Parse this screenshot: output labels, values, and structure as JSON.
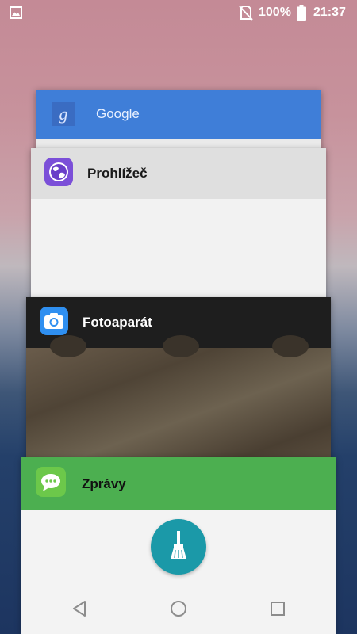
{
  "status_bar": {
    "icons": [
      "image-notification-icon",
      "no-sim-icon",
      "battery-full-icon"
    ],
    "battery": "100%",
    "time": "21:37"
  },
  "recent_apps": [
    {
      "name": "Google",
      "icon": "google-search-icon",
      "header_color": "#3f7ed8"
    },
    {
      "name": "Prohlížeč",
      "icon": "browser-globe-icon",
      "header_color": "#dfdfdf"
    },
    {
      "name": "Fotoaparát",
      "icon": "camera-icon",
      "header_color": "#1e1e1e"
    },
    {
      "name": "Zprávy",
      "icon": "messages-icon",
      "header_color": "#4caf50"
    }
  ],
  "clear_all": {
    "icon": "broom-icon",
    "color": "#1b99a8"
  },
  "navigation_bar": {
    "icons": [
      "back-icon",
      "home-icon",
      "recents-icon"
    ]
  }
}
